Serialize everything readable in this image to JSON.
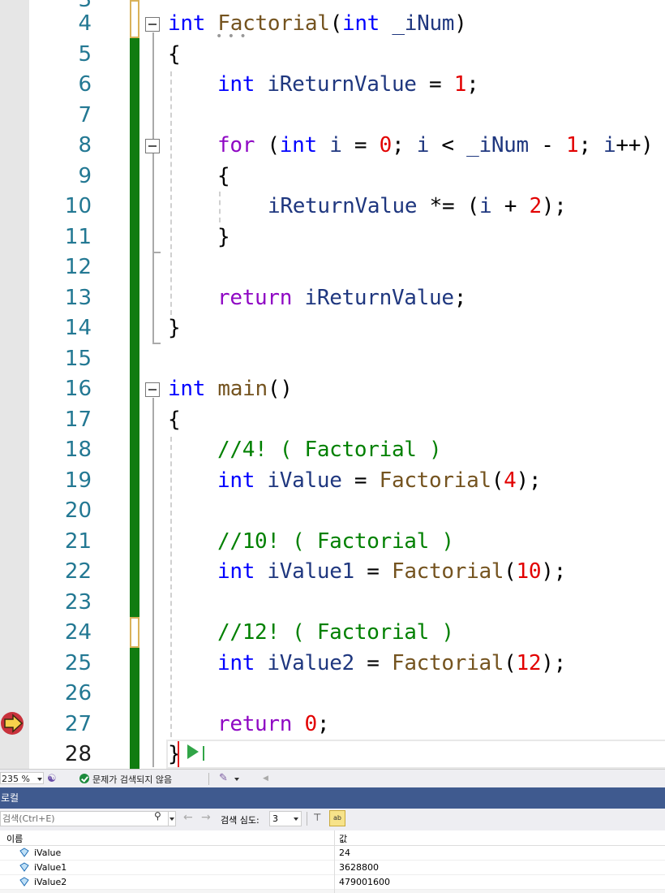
{
  "editor": {
    "line_numbers": [
      "3",
      "4",
      "5",
      "6",
      "7",
      "8",
      "9",
      "10",
      "11",
      "12",
      "13",
      "14",
      "15",
      "16",
      "17",
      "18",
      "19",
      "20",
      "21",
      "22",
      "23",
      "24",
      "25",
      "26",
      "27",
      "28"
    ],
    "lines": {
      "l4": {
        "kw1": "int",
        "fn": "Factorial",
        "p1": "(",
        "kw2": "int",
        "param": "_iNum",
        "p2": ")"
      },
      "l5": {
        "brace": "{"
      },
      "l6": {
        "kw": "int",
        "var": "iReturnValue",
        "op": " = ",
        "num": "1",
        "end": ";"
      },
      "l8": {
        "kw_for": "for",
        "p1": " (",
        "kw_int": "int",
        "v1": "i",
        "op1": " = ",
        "n0": "0",
        "s1": "; ",
        "v2": "i",
        "op2": " < ",
        "v3": "_iNum",
        "op3": " - ",
        "n1": "1",
        "s2": "; ",
        "v4": "i",
        "inc": "++)"
      },
      "l9": {
        "brace": "{"
      },
      "l10": {
        "var": "iReturnValue",
        "op": " *= (",
        "v2": "i",
        "op2": " + ",
        "num": "2",
        "end": ");"
      },
      "l11": {
        "brace": "}"
      },
      "l13": {
        "kw": "return",
        "sp": " ",
        "var": "iReturnValue",
        "end": ";"
      },
      "l14": {
        "brace": "}"
      },
      "l16": {
        "kw": "int",
        "fn": "main",
        "p": "()"
      },
      "l17": {
        "brace": "{"
      },
      "l18": {
        "comment": "//4! ( Factorial )"
      },
      "l19": {
        "kw": "int",
        "var": "iValue",
        "op": " = ",
        "fn": "Factorial",
        "p1": "(",
        "num": "4",
        "end": ");"
      },
      "l21": {
        "comment": "//10! ( Factorial )"
      },
      "l22": {
        "kw": "int",
        "var": "iValue1",
        "op": " = ",
        "fn": "Factorial",
        "p1": "(",
        "num": "10",
        "end": ");"
      },
      "l24": {
        "comment": "//12! ( Factorial )"
      },
      "l25": {
        "kw": "int",
        "var": "iValue2",
        "op": " = ",
        "fn": "Factorial",
        "p1": "(",
        "num": "12",
        "end": ");"
      },
      "l27": {
        "kw": "return",
        "sp": " ",
        "num": "0",
        "end": ";"
      },
      "l28": {
        "brace": "}"
      }
    },
    "icons": {
      "exec_arrow": "current-statement-arrow-icon",
      "run_to_click": "run-to-click-icon",
      "fold": "collapse-minus-icon"
    }
  },
  "status_bar": {
    "zoom": "235 %",
    "issues_text": "문제가 검색되지 않음"
  },
  "locals": {
    "title": "로컬",
    "search_placeholder": "검색(Ctrl+E)",
    "search_depth_label": "검색 심도:",
    "search_depth_value": "3",
    "hex_label": "ab",
    "columns": {
      "name": "이름",
      "value": "값"
    },
    "rows": [
      {
        "name": "iValue",
        "value": "24"
      },
      {
        "name": "iValue1",
        "value": "3628800"
      },
      {
        "name": "iValue2",
        "value": "479001600"
      }
    ]
  },
  "colors": {
    "keyword": "#0000ff",
    "control": "#8f08c4",
    "function": "#74531f",
    "variable": "#1f377f",
    "number": "#e20000",
    "comment": "#008000",
    "change_bar": "#107c10",
    "locals_title_bg": "#3f5a8f"
  }
}
